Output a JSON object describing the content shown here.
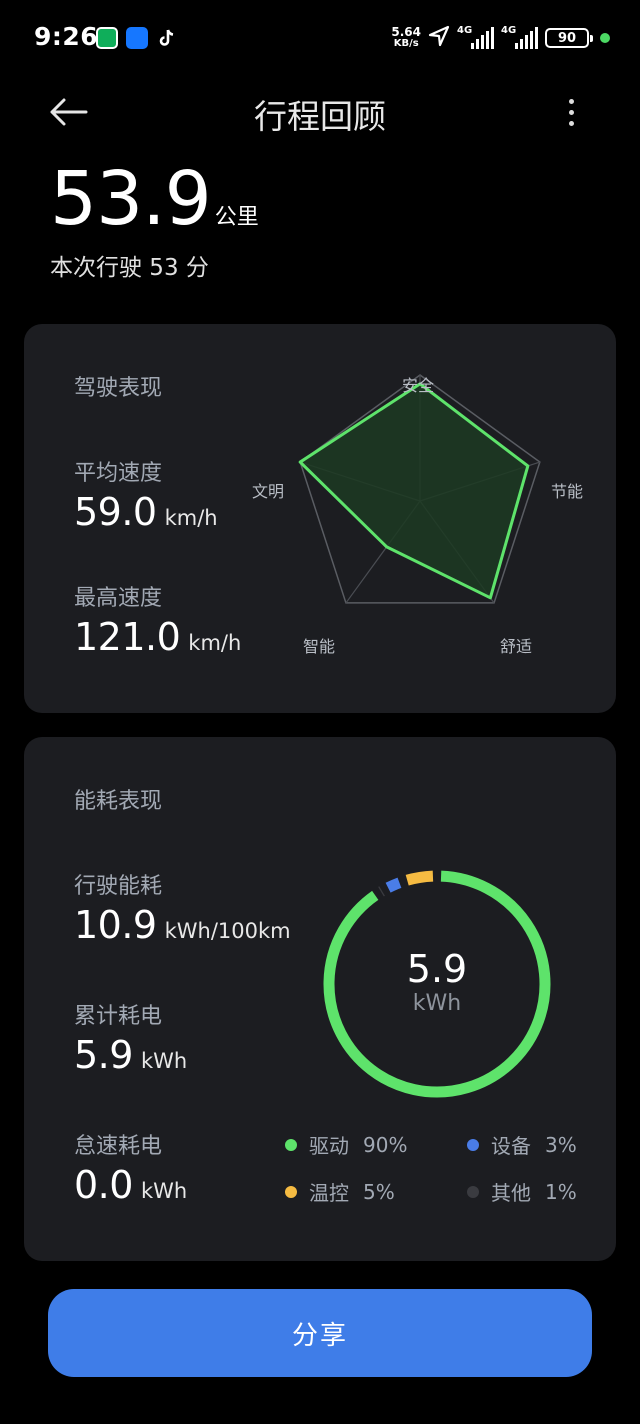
{
  "status_bar": {
    "time": "9:26",
    "net_speed_value": "5.64",
    "net_speed_unit": "KB/s",
    "signal1_tag": "4G",
    "signal2_tag": "4G",
    "battery": "90",
    "app_icons": [
      "wechat-pay-icon",
      "alipay-icon",
      "tiktok-icon"
    ],
    "accent_online": "#4cd964"
  },
  "header": {
    "title": "行程回顾",
    "back_icon": "back-arrow-icon",
    "more_icon": "more-vertical-icon"
  },
  "summary": {
    "distance_value": "53.9",
    "distance_unit": "公里",
    "duration": "本次行驶 53 分"
  },
  "driving_card": {
    "title": "驾驶表现",
    "avg_speed_label": "平均速度",
    "avg_speed_value": "59.0",
    "avg_speed_unit": "km/h",
    "max_speed_label": "最高速度",
    "max_speed_value": "121.0",
    "max_speed_unit": "km/h",
    "radar": {
      "axes": [
        "安全",
        "节能",
        "舒适",
        "智能",
        "文明"
      ],
      "scores": [
        0.93,
        0.9,
        0.95,
        0.45,
        1.0
      ],
      "line_color": "#5ee36b",
      "fill_color": "#1c3a22"
    }
  },
  "energy_card": {
    "title": "能耗表现",
    "driving_energy_label": "行驶能耗",
    "driving_energy_value": "10.9",
    "driving_energy_unit": "kWh/100km",
    "total_energy_label": "累计耗电",
    "total_energy_value": "5.9",
    "total_energy_unit": "kWh",
    "idle_energy_label": "怠速耗电",
    "idle_energy_value": "0.0",
    "idle_energy_unit": "kWh",
    "ring_value": "5.9",
    "ring_unit": "kWh",
    "breakdown": [
      {
        "name": "驱动",
        "percent_label": "90%",
        "percent": 90,
        "color": "#5ee36b"
      },
      {
        "name": "设备",
        "percent_label": "3%",
        "percent": 3,
        "color": "#4a7de8"
      },
      {
        "name": "温控",
        "percent_label": "5%",
        "percent": 5,
        "color": "#f5bb42"
      },
      {
        "name": "其他",
        "percent_label": "1%",
        "percent": 1,
        "color": "#3a3b40"
      }
    ]
  },
  "share_button": {
    "label": "分享",
    "color": "#3f7de8"
  }
}
